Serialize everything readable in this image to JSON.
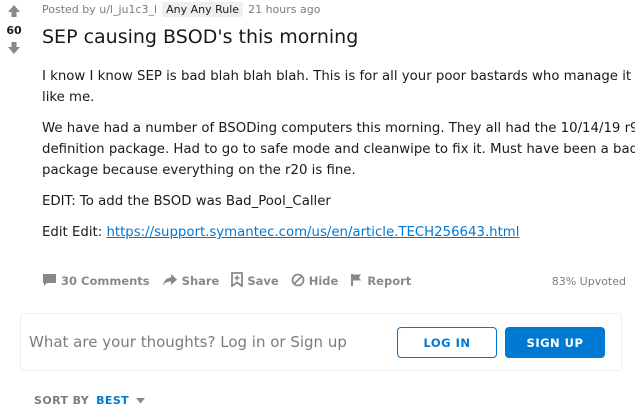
{
  "post": {
    "votes": "60",
    "meta": {
      "posted_by": "Posted by u/l_ju1c3_l",
      "flair": "Any Any Rule",
      "time": "21 hours ago"
    },
    "title": "SEP causing BSOD's this morning",
    "body": {
      "p1_line1": "I know I know SEP is bad blah blah blah. This is for all your poor bastards who manage it",
      "p1_line2": "like me.",
      "p2_line1": "We have had a number of BSODing computers this morning. They all had the 10/14/19 r9",
      "p2_line2": "definition package. Had to go to safe mode and cleanwipe to fix it. Must have been a bad",
      "p2_line3": "package because everything on the r20 is fine.",
      "p3": "EDIT: To add the BSOD was Bad_Pool_Caller",
      "p4_prefix": "Edit Edit: ",
      "p4_link": "https://support.symantec.com/us/en/article.TECH256643.html"
    },
    "actions": {
      "comments": "30 Comments",
      "share": "Share",
      "save": "Save",
      "hide": "Hide",
      "report": "Report",
      "upvoted": "83% Upvoted"
    }
  },
  "comment_box": {
    "prompt": "What are your thoughts? Log in or Sign up",
    "login_label": "LOG IN",
    "signup_label": "SIGN UP"
  },
  "sort": {
    "label": "SORT BY",
    "value": "BEST"
  },
  "colors": {
    "accent": "#0079d3",
    "muted": "#878a8c"
  }
}
